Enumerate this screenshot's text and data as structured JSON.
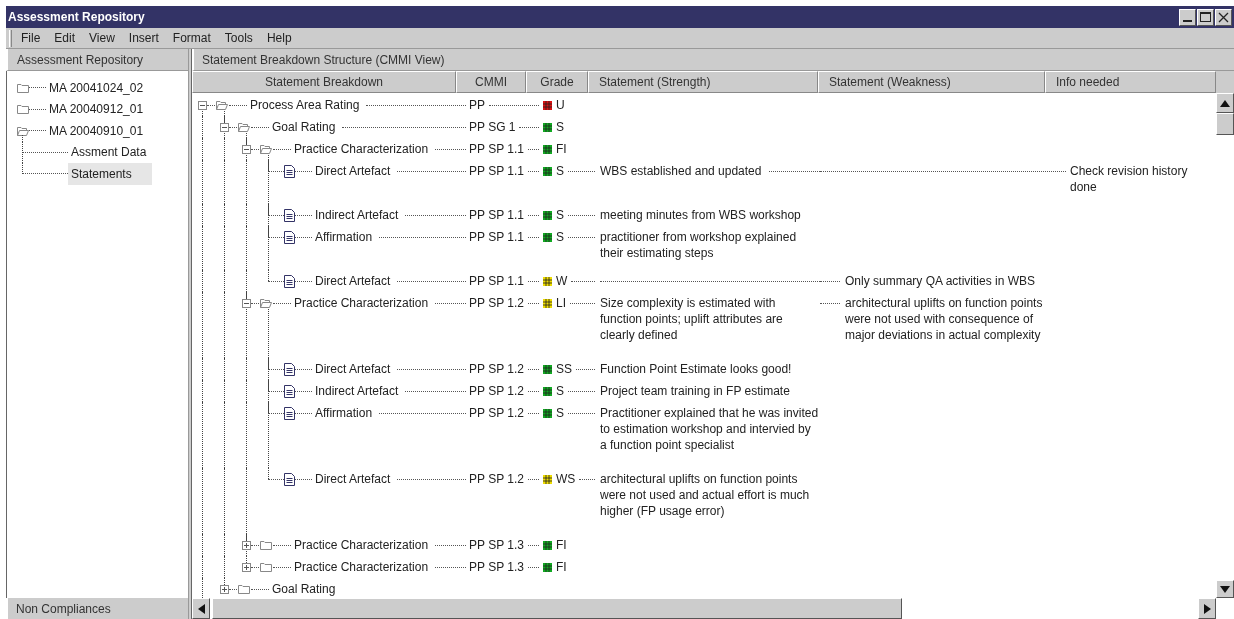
{
  "window": {
    "title": "Assessment Repository"
  },
  "menu": [
    "File",
    "Edit",
    "View",
    "Insert",
    "Format",
    "Tools",
    "Help"
  ],
  "sidebar": {
    "title": "Assessment Repository",
    "footer": "Non Compliances",
    "items": [
      {
        "label": "MA 20041024_02",
        "expanded": false,
        "selected": false
      },
      {
        "label": "MA 20040912_01",
        "expanded": false,
        "selected": false
      },
      {
        "label": "MA 20040910_01",
        "expanded": true,
        "selected": false,
        "children": [
          {
            "label": "Assment Data",
            "selected": false
          },
          {
            "label": "Statements",
            "selected": true
          }
        ]
      }
    ]
  },
  "main": {
    "title": "Statement Breakdown Structure (CMMI View)",
    "columns": [
      "Statement Breakdown",
      "CMMI",
      "Grade",
      "Statement (Strength)",
      "Statement (Weakness)",
      "Info needed"
    ],
    "rows": [
      {
        "kind": "folder",
        "label": "Process Area Rating",
        "cmmi": "PP",
        "grade": "U",
        "color": "#dd1111",
        "expanded": true,
        "children": [
          {
            "kind": "folder",
            "label": "Goal Rating",
            "cmmi": "PP SG 1",
            "grade": "S",
            "color": "#11aa22",
            "expanded": true,
            "children": [
              {
                "kind": "folder",
                "label": "Practice Characterization",
                "cmmi": "PP SP 1.1",
                "grade": "FI",
                "color": "#11aa22",
                "expanded": true,
                "children": [
                  {
                    "kind": "document",
                    "label": "Direct Artefact",
                    "cmmi": "PP SP 1.1",
                    "grade": "S",
                    "color": "#11aa22",
                    "strength": "WBS established and updated",
                    "info": "Check revision history done"
                  },
                  {
                    "kind": "document",
                    "label": "Indirect Artefact",
                    "cmmi": "PP SP 1.1",
                    "grade": "S",
                    "color": "#11aa22",
                    "strength": "meeting minutes from WBS workshop"
                  },
                  {
                    "kind": "document",
                    "label": "Affirmation",
                    "cmmi": "PP SP 1.1",
                    "grade": "S",
                    "color": "#11aa22",
                    "strength": "practitioner from workshop explained their estimating steps"
                  },
                  {
                    "kind": "document",
                    "label": "Direct Artefact",
                    "cmmi": "PP SP 1.1",
                    "grade": "W",
                    "color": "#eedd00",
                    "weakness": "Only summary QA activities in WBS"
                  }
                ]
              },
              {
                "kind": "folder",
                "label": "Practice Characterization",
                "cmmi": "PP SP 1.2",
                "grade": "LI",
                "color": "#eedd00",
                "expanded": true,
                "strength": "Size complexity is estimated with function points; uplift attributes are clearly defined",
                "weakness": "architectural uplifts on function points were not used with consequence of major  deviations in actual complexity",
                "children": [
                  {
                    "kind": "document",
                    "label": "Direct Artefact",
                    "cmmi": "PP SP 1.2",
                    "grade": "SS",
                    "color": "#11aa22",
                    "strength": "Function Point Estimate looks good!"
                  },
                  {
                    "kind": "document",
                    "label": "Indirect Artefact",
                    "cmmi": "PP SP 1.2",
                    "grade": "S",
                    "color": "#11aa22",
                    "strength": "Project team training in FP estimate"
                  },
                  {
                    "kind": "document",
                    "label": "Affirmation",
                    "cmmi": "PP SP 1.2",
                    "grade": "S",
                    "color": "#11aa22",
                    "strength": "Practitioner explained that he was invited to estimation workshop and intervied by a function point specialist"
                  },
                  {
                    "kind": "document",
                    "label": "Direct Artefact",
                    "cmmi": "PP SP 1.2",
                    "grade": "WS",
                    "color": "#eedd00",
                    "strength": "architectural uplifts on function points were not used and actual effort is much higher (FP usage error)"
                  }
                ]
              },
              {
                "kind": "folder",
                "label": "Practice Characterization",
                "cmmi": "PP SP 1.3",
                "grade": "FI",
                "color": "#11aa22",
                "expanded": false
              },
              {
                "kind": "folder",
                "label": "Practice Characterization",
                "cmmi": "PP SP 1.3",
                "grade": "FI",
                "color": "#11aa22",
                "expanded": false
              }
            ]
          },
          {
            "kind": "folder",
            "label": "Goal Rating",
            "expanded": false
          }
        ]
      }
    ]
  }
}
